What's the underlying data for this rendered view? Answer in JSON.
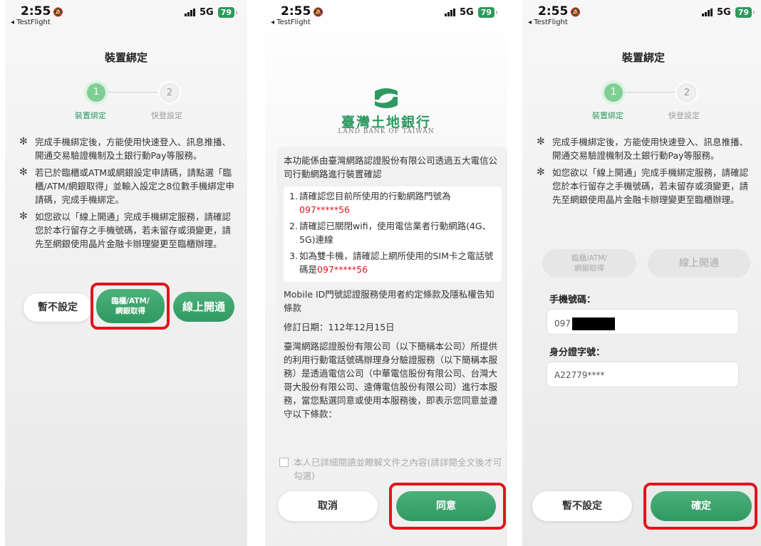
{
  "status_bar": {
    "time": "2:55",
    "back_app": "◂ TestFlight",
    "network": "5G",
    "battery": "79"
  },
  "screen1": {
    "title": "裝置綁定",
    "steps": [
      {
        "num": "1",
        "label": "裝置綁定"
      },
      {
        "num": "2",
        "label": "快登設定"
      }
    ],
    "notes": [
      "完成手機綁定後，方能使用快速登入、訊息推播、開通交易驗證機制及土銀行動Pay等服務。",
      "若已於臨櫃或ATM或網銀設定申請碼，請點選「臨櫃/ATM/網銀取得」並輸入設定之8位數手機綁定申請碼，完成手機綁定。",
      "如您欲以「線上開通」完成手機綁定服務，請確認您於本行留存之手機號碼，若未留存或須變更，請先至網銀使用晶片金融卡辦理變更至臨櫃辦理。"
    ],
    "buttons": {
      "skip": "暫不設定",
      "counter_line1": "臨櫃/ATM/",
      "counter_line2": "網銀取得",
      "online": "線上開通"
    }
  },
  "screen2": {
    "logo_name": "臺灣土地銀行",
    "logo_en": "LAND BANK OF TAIWAN",
    "intro": "本功能係由臺灣網路認證股份有限公司透過五大電信公司行動網路進行裝置確認",
    "checks": [
      {
        "n": "1.",
        "text": "請確認您目前所使用的行動網路門號為",
        "highlight": "097*****56"
      },
      {
        "n": "2.",
        "text": "請確認已關閉wifi，使用電信業者行動網路(4G、5G)連線",
        "highlight": ""
      },
      {
        "n": "3.",
        "text": "如為雙卡機，請確認上網所使用的SIM卡之電話號碼是",
        "highlight": "097*****56"
      }
    ],
    "terms_title": "Mobile ID門號認證服務使用者約定條款及隱私權告知條款",
    "revised": "修訂日期：112年12月15日",
    "terms_body": "臺灣網路認證股份有限公司（以下簡稱本公司）所提供的利用行動電話號碼辦理身分驗證服務（以下簡稱本服務）是透過電信公司（中華電信股份有限公司、台灣大哥大股份有限公司、遠傳電信股份有限公司）進行本服務，當您點選同意或使用本服務後，即表示您同意並遵守以下條款：",
    "agree_text": "本人已詳細閱讀並瞭解文件之內容(請詳閱全文後才可勾選)",
    "buttons": {
      "cancel": "取消",
      "agree": "同意"
    }
  },
  "screen3": {
    "title": "裝置綁定",
    "steps": [
      {
        "num": "1",
        "label": "裝置綁定"
      },
      {
        "num": "2",
        "label": "快登設定"
      }
    ],
    "notes": [
      "完成手機綁定後，方能使用快速登入、訊息推播、開通交易驗證機制及土銀行動Pay等服務。",
      "如您欲以「線上開通」完成手機綁定服務，請確認您於本行留存之手機號碼，若未留存或須變更，請先至網銀使用晶片金融卡辦理變更至臨櫃辦理。"
    ],
    "toggle": {
      "counter_line1": "臨櫃/ATM/",
      "counter_line2": "網銀取得",
      "online": "線上開通"
    },
    "phone_label": "手機號碼：",
    "phone_value": "097",
    "id_label": "身分證字號：",
    "id_value": "A22779****",
    "buttons": {
      "skip": "暫不設定",
      "confirm": "確定"
    }
  }
}
